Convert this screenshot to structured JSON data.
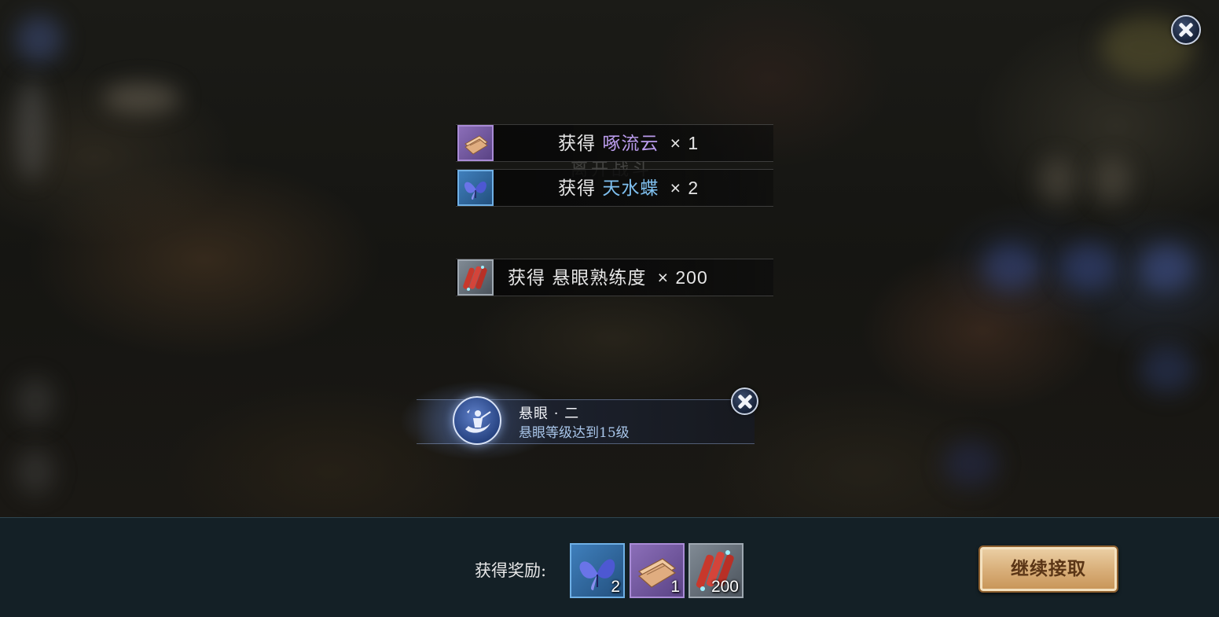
{
  "notices": [
    {
      "prefix": "获得",
      "item": "啄流云",
      "mult": "×",
      "count": "1",
      "item_color": "#b99aeb",
      "icon": "scroll-bundle-icon"
    },
    {
      "prefix": "获得",
      "item": "天水蝶",
      "mult": "×",
      "count": "2",
      "item_color": "#7fc0f0",
      "icon": "butterfly-icon"
    },
    {
      "prefix": "获得",
      "item": "悬眼熟练度",
      "mult": "×",
      "count": "200",
      "item_color": "#e6e6e6",
      "icon": "scroll-rolls-icon"
    }
  ],
  "faint_background_text": "离开战斗",
  "achievement": {
    "title": "悬眼 · 二",
    "description": "悬眼等级达到15级"
  },
  "bottom_bar": {
    "reward_label": "获得奖励:",
    "rewards": [
      {
        "icon": "butterfly-icon",
        "count": "2",
        "frame": "blue"
      },
      {
        "icon": "scroll-bundle-icon",
        "count": "1",
        "frame": "purple"
      },
      {
        "icon": "scroll-rolls-icon",
        "count": "200",
        "frame": "gray"
      }
    ],
    "continue_label": "继续接取"
  },
  "colors": {
    "purple_frame": "#a98bd6",
    "blue_frame": "#6fb0e6",
    "gray_frame": "#9fa8b1",
    "bottom_bar": "#142026",
    "button_gold": "#d9b07b"
  }
}
